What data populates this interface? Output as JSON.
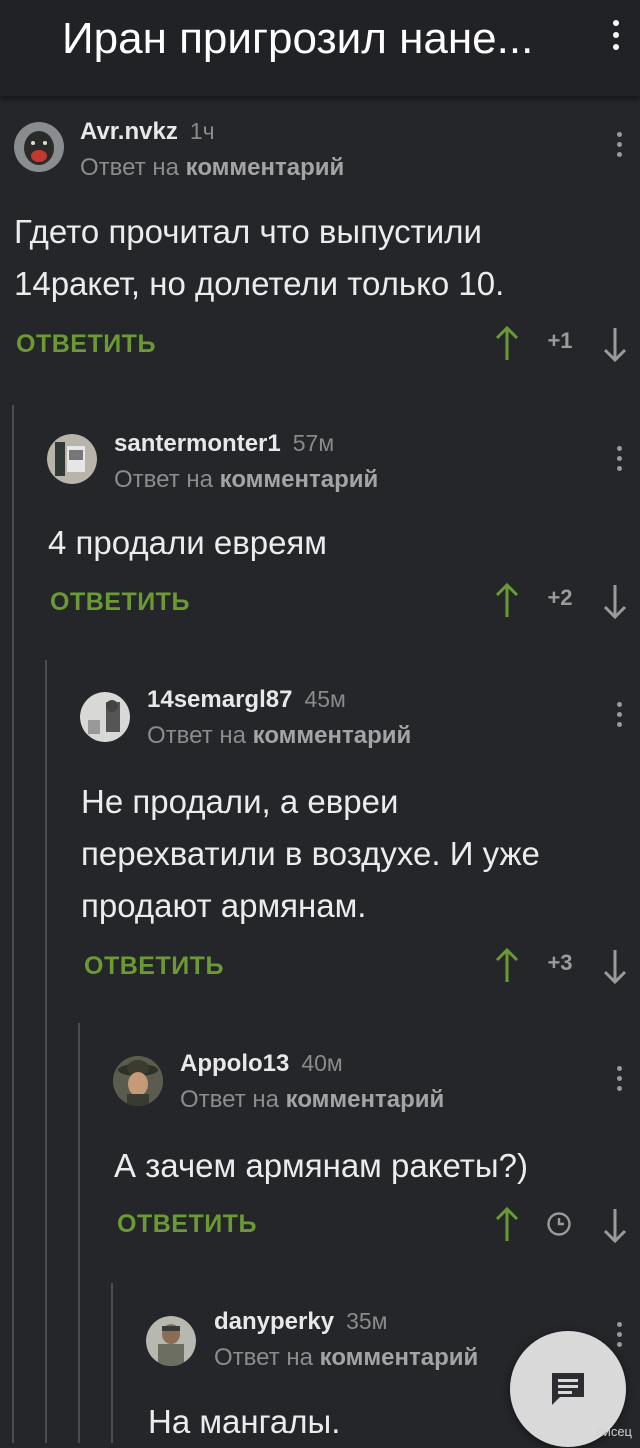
{
  "header": {
    "title": "Иран пригрозил нане..."
  },
  "reply_label": "ОТВЕТИТЬ",
  "reply_prefix": "Ответ на",
  "reply_target": "комментарий",
  "comments": [
    {
      "user": "Avr.nvkz",
      "time": "1ч",
      "text": "Гдето прочитал что выпустили 14ракет, но долетели только 10.",
      "score": "+1"
    },
    {
      "user": "santermonter1",
      "time": "57м",
      "text": "4 продали евреям",
      "score": "+2"
    },
    {
      "user": "14semargl87",
      "time": "45м",
      "text": "Не продали, а евреи перехватили в воздухе. И уже продают армянам.",
      "score": "+3"
    },
    {
      "user": "Appolo13",
      "time": "40м",
      "text": "А зачем армянам ракеты?)",
      "score": "",
      "score_icon": "clock-icon"
    },
    {
      "user": "danyperky",
      "time": "35м",
      "text": "На мангалы.",
      "score": ""
    }
  ],
  "fab_icon": "comment-icon",
  "watermark": "писец",
  "colors": {
    "accent": "#6b9a34",
    "background": "#24262a",
    "upvote": "#6b9a34"
  }
}
